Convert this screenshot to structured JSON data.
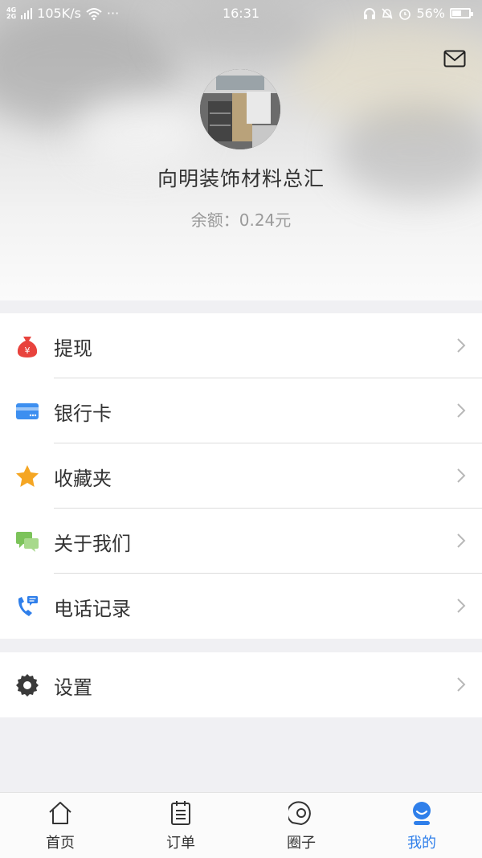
{
  "status_bar": {
    "network_top": "4G",
    "network_bottom": "2G",
    "speed": "105K/s",
    "more": "···",
    "time": "16:31",
    "battery_percent": "56%",
    "battery_level": 0.56
  },
  "profile": {
    "name": "向明装饰材料总汇",
    "balance_label": "余额：",
    "balance_value": "0.24元"
  },
  "menu": {
    "group1": [
      {
        "label": "提现",
        "icon": "money-bag-icon",
        "color": "#e8433d"
      },
      {
        "label": "银行卡",
        "icon": "bank-card-icon",
        "color": "#3d8ff0"
      },
      {
        "label": "收藏夹",
        "icon": "star-icon",
        "color": "#f5a623"
      },
      {
        "label": "关于我们",
        "icon": "chat-bubbles-icon",
        "color": "#7cc35a"
      },
      {
        "label": "电话记录",
        "icon": "phone-log-icon",
        "color": "#2f7fea"
      }
    ],
    "group2": [
      {
        "label": "设置",
        "icon": "gear-icon",
        "color": "#333333"
      }
    ]
  },
  "tabs": [
    {
      "label": "首页",
      "icon": "home-icon",
      "active": false
    },
    {
      "label": "订单",
      "icon": "order-list-icon",
      "active": false
    },
    {
      "label": "圈子",
      "icon": "circle-icon",
      "active": false
    },
    {
      "label": "我的",
      "icon": "profile-icon",
      "active": true
    }
  ],
  "colors": {
    "accent": "#2f7fea",
    "background": "#f0f0f3"
  }
}
